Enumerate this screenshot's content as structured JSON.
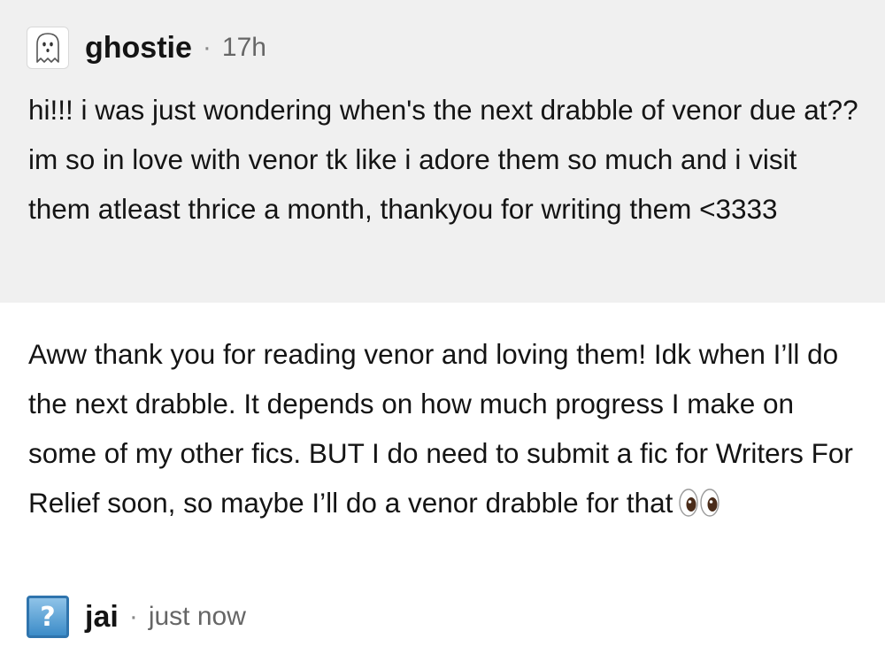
{
  "ask": {
    "avatar_icon": "ghost-icon",
    "username": "ghostie",
    "separator": "·",
    "time": "17h",
    "body": "hi!!! i was just wondering when's the next drabble of venor due at?? im so in love with venor tk like i adore them so much and i visit them atleast thrice a month, thankyou for writing them <3333"
  },
  "answer": {
    "body": "Aww thank you for reading venor and loving them! Idk when I’ll do the next drabble. It depends on how much progress I make on some of my other fics. BUT I do need to submit a fic for Writers For Relief soon, so maybe I’ll do a venor drabble for that",
    "emoji_icon": "eyes-emoji-icon"
  },
  "reply": {
    "avatar_icon": "question-mark-icon",
    "avatar_glyph": "?",
    "username": "jai",
    "separator": "·",
    "time": "just now"
  },
  "colors": {
    "ask_background": "#f0f0f0",
    "page_background": "#ffffff",
    "text": "#141414",
    "muted_text": "#666666"
  }
}
